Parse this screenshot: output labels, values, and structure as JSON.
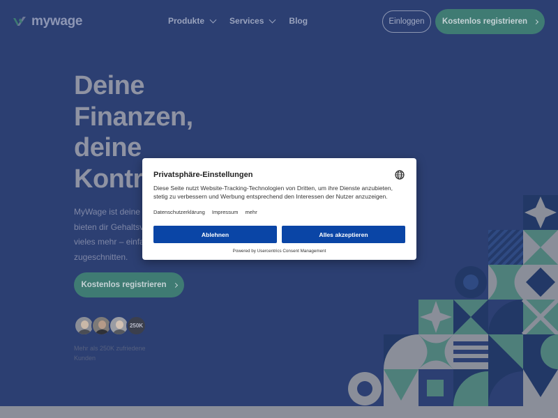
{
  "brand": {
    "name": "mywage"
  },
  "nav": {
    "items": [
      {
        "label": "Produkte",
        "dropdown": true
      },
      {
        "label": "Services",
        "dropdown": true
      },
      {
        "label": "Blog",
        "dropdown": false
      }
    ],
    "login_label": "Einloggen",
    "register_label": "Kostenlos registrieren"
  },
  "hero": {
    "title_lines": [
      "Deine",
      "Finanzen,",
      "deine",
      "Kontr"
    ],
    "description_lines": [
      "MyWage ist deine",
      "bieten dir Gehaltsv",
      "vieles mehr – einfa",
      "zugeschnitten."
    ],
    "cta_label": "Kostenlos registrieren",
    "customer_count_badge": "250K",
    "customers_text_lines": [
      "Mehr als 250K zufriedene",
      "Kunden"
    ]
  },
  "consent": {
    "title": "Privatsphäre-Einstellungen",
    "text_lines": [
      "Diese Seite nutzt Website-Tracking-Technologien von Dritten, um ihre Dienste anzubieten,",
      "stetig zu verbessern und Werbung entsprechend den Interessen der Nutzer anzuzeigen."
    ],
    "links": [
      "Datenschutzerklärung",
      "Impressum",
      "mehr"
    ],
    "decline_label": "Ablehnen",
    "accept_label": "Alles akzeptieren",
    "powered_by": "Powered by Usercentrics Consent Management",
    "language_icon": "globe-icon"
  },
  "colors": {
    "background": "#2c3f72",
    "accent_green": "#3f7b73",
    "consent_button": "#0a45a6",
    "pattern_navy": "#223866",
    "pattern_grey": "#8a8e99",
    "pattern_teal": "#4e7f7a"
  }
}
